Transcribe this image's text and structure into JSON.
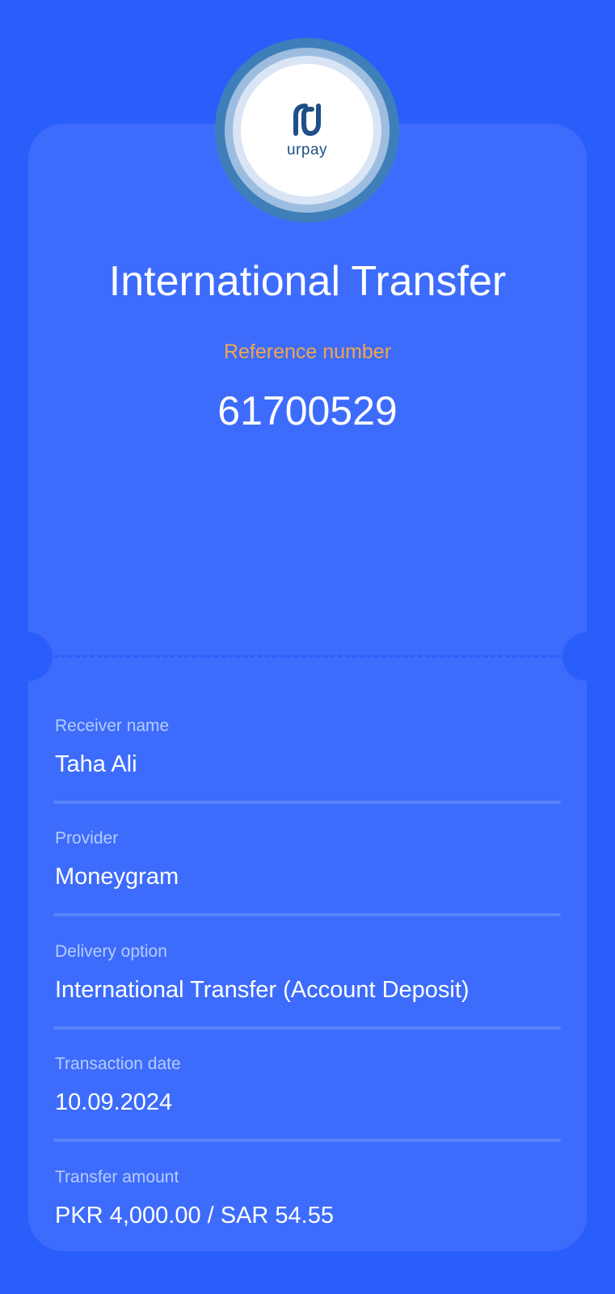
{
  "brand": {
    "name": "urpay",
    "logo_icon": "urpay-logo-icon"
  },
  "receipt": {
    "title": "International Transfer",
    "reference_label": "Reference number",
    "reference_number": "61700529"
  },
  "details": [
    {
      "label": "Receiver name",
      "value": "Taha Ali"
    },
    {
      "label": "Provider",
      "value": "Moneygram"
    },
    {
      "label": "Delivery option",
      "value": "International Transfer (Account Deposit)"
    },
    {
      "label": "Transaction date",
      "value": "10.09.2024"
    },
    {
      "label": "Transfer amount",
      "value": "PKR 4,000.00 / SAR 54.55"
    }
  ],
  "colors": {
    "background": "#2a5efb",
    "card": "#3d6cfc",
    "reference_label": "#f0a64b",
    "brand_dark": "#1f4f87"
  }
}
